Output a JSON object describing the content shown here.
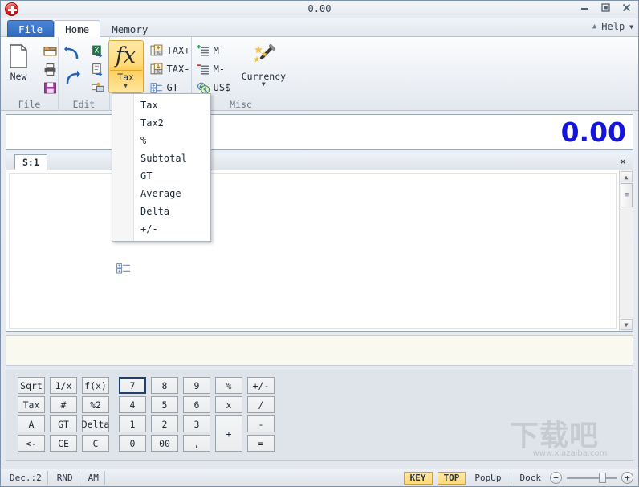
{
  "window": {
    "title": "0.00",
    "app_icon": "red-orb-icon",
    "controls": [
      {
        "name": "minimize-button",
        "glyph": "—"
      },
      {
        "name": "maximize-button",
        "glyph": "□"
      },
      {
        "name": "close-button",
        "glyph": "✕"
      }
    ]
  },
  "tabs": [
    {
      "id": "file",
      "label": "File",
      "active": false,
      "style": "file"
    },
    {
      "id": "home",
      "label": "Home",
      "active": true,
      "style": "normal"
    },
    {
      "id": "memory",
      "label": "Memory",
      "active": false,
      "style": "normal"
    }
  ],
  "help": {
    "collapse_icon": "chevron-up-icon",
    "label": "Help",
    "dropdown_icon": "chevron-down-icon"
  },
  "ribbon": {
    "groups": [
      {
        "id": "file",
        "label": "File",
        "big_buttons": [
          {
            "id": "new",
            "label": "New",
            "icon": "new-document-icon"
          }
        ],
        "small_buttons": [
          {
            "id": "open",
            "label": "",
            "icon": "open-folder-icon"
          },
          {
            "id": "print",
            "label": "",
            "icon": "printer-icon"
          },
          {
            "id": "save",
            "label": "",
            "icon": "save-floppy-icon"
          }
        ]
      },
      {
        "id": "edit",
        "label": "Edit",
        "small_buttons": [
          {
            "id": "undo",
            "label": "",
            "icon": "undo-arrow-icon"
          },
          {
            "id": "redo",
            "label": "",
            "icon": "redo-arrow-icon"
          },
          {
            "id": "export-excel",
            "label": "",
            "icon": "excel-export-icon"
          },
          {
            "id": "export-doc",
            "label": "",
            "icon": "document-export-icon"
          },
          {
            "id": "send-screen",
            "label": "",
            "icon": "send-to-screen-icon"
          }
        ]
      },
      {
        "id": "tax",
        "label": "",
        "big_button": {
          "id": "tax",
          "label": "Tax",
          "icon": "fx-function-icon",
          "glyph": "fx",
          "has_dropdown": true,
          "active": true
        },
        "small_buttons": [
          {
            "id": "tax-plus",
            "label": "TAX+",
            "icon": "tax-plus-icon"
          },
          {
            "id": "tax-minus",
            "label": "TAX-",
            "icon": "tax-minus-icon"
          },
          {
            "id": "gt",
            "label": "GT",
            "icon": "grand-total-icon"
          }
        ]
      },
      {
        "id": "misc",
        "label": "Misc",
        "small_buttons": [
          {
            "id": "memory-plus",
            "label": "M+",
            "icon": "memory-plus-icon"
          },
          {
            "id": "memory-minus",
            "label": "M-",
            "icon": "memory-minus-icon"
          },
          {
            "id": "us-dollar",
            "label": "US$",
            "icon": "currency-dollar-icon"
          }
        ],
        "big_buttons": [
          {
            "id": "currency",
            "label": "Currency",
            "icon": "magic-wand-icon",
            "has_dropdown": true
          }
        ]
      }
    ]
  },
  "tax_menu": {
    "open": true,
    "items": [
      {
        "id": "tax",
        "label": "Tax",
        "icon": ""
      },
      {
        "id": "tax2",
        "label": "Tax2",
        "icon": ""
      },
      {
        "id": "percent",
        "label": "%",
        "icon": ""
      },
      {
        "id": "subtotal",
        "label": "Subtotal",
        "icon": ""
      },
      {
        "id": "gt",
        "label": "GT",
        "icon": "grand-total-icon"
      },
      {
        "id": "average",
        "label": "Average",
        "icon": ""
      },
      {
        "id": "delta",
        "label": "Delta",
        "icon": ""
      },
      {
        "id": "plusminus",
        "label": "+/-",
        "icon": ""
      }
    ]
  },
  "display": {
    "value": "0.00",
    "color": "#1414dc"
  },
  "tape": {
    "sheet_tab": "S:1",
    "close_glyph": "✕",
    "content": "",
    "scrollbar": {
      "up_glyph": "▲",
      "down_glyph": "▼",
      "thumb_grip": "≡"
    }
  },
  "keypad": {
    "left_rows": [
      [
        "Sqrt",
        "1/x",
        "f(x)"
      ],
      [
        "Tax",
        "#",
        "%2"
      ],
      [
        "A",
        "GT",
        "Delta"
      ],
      [
        "<-",
        "CE",
        "C"
      ]
    ],
    "digit_rows": [
      [
        "7",
        "8",
        "9"
      ],
      [
        "4",
        "5",
        "6"
      ],
      [
        "1",
        "2",
        "3"
      ],
      [
        "0",
        "00",
        ","
      ]
    ],
    "op_col1": [
      "%",
      "x"
    ],
    "plus": "+",
    "op_col2": [
      "+/-",
      "/",
      "-",
      "="
    ],
    "focused_key": "7"
  },
  "statusbar": {
    "fields": [
      {
        "id": "decimals",
        "label": "Dec.:2"
      },
      {
        "id": "rounding",
        "label": "RND"
      },
      {
        "id": "mode",
        "label": "AM"
      }
    ],
    "right": {
      "key_toggle": "KEY",
      "top_toggle": "TOP",
      "popup_button": "PopUp",
      "dock_button": "Dock",
      "zoom_out": "−",
      "zoom_in": "+"
    }
  },
  "watermark": {
    "text": "下载吧",
    "url": "www.xiazaiba.com"
  },
  "colors": {
    "accent_blue": "#2f69bd",
    "display_value": "#1414dc",
    "highlight_yellow": "#ffd978",
    "tape_paper": "#ffffff",
    "cream_strip": "#f9f9f0"
  }
}
